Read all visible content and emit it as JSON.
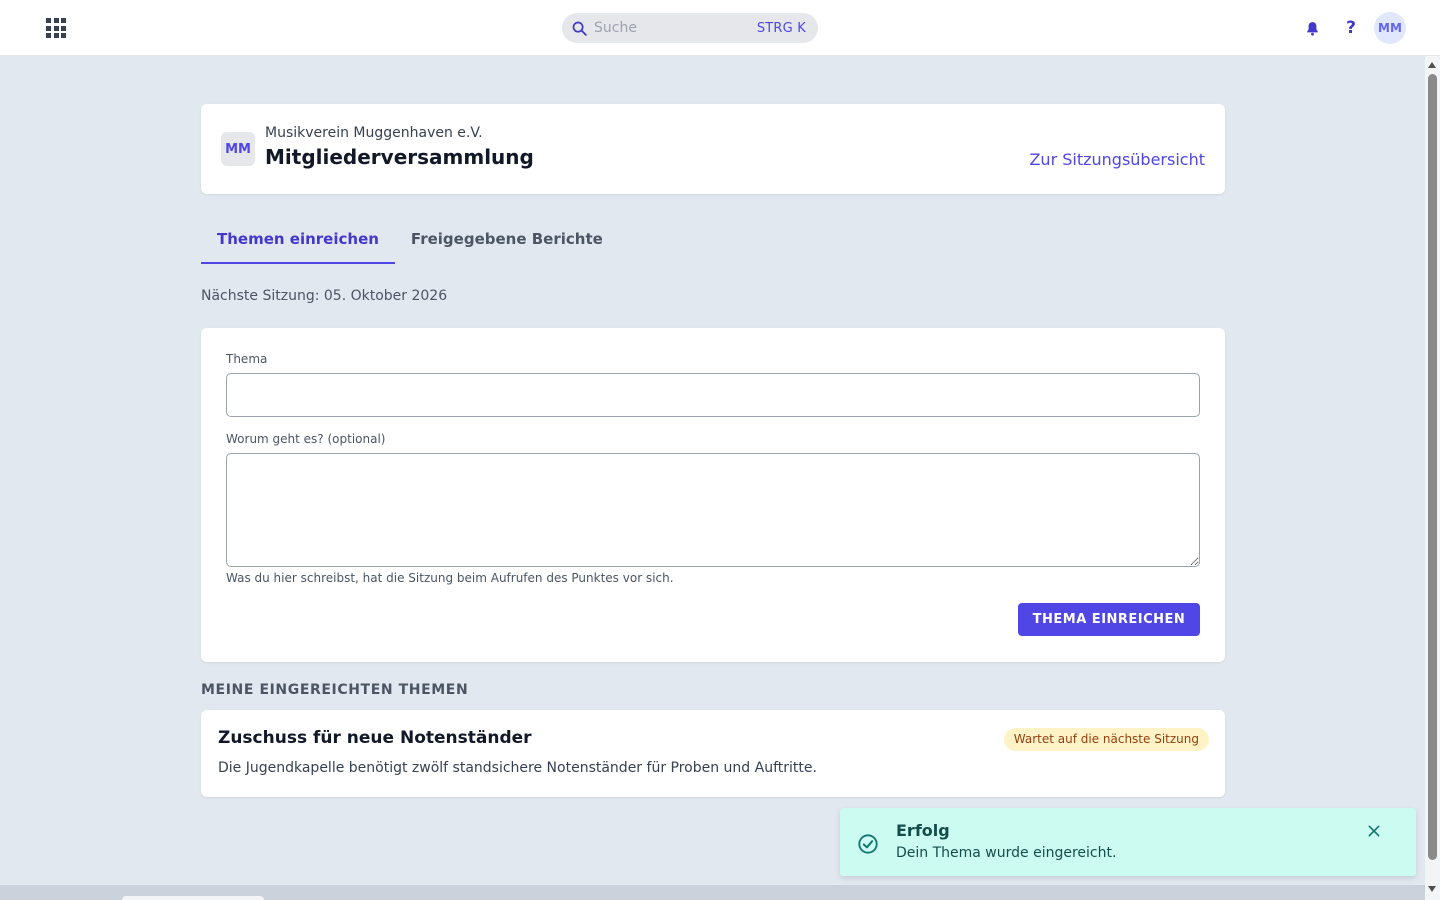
{
  "topbar": {
    "search_placeholder": "Suche",
    "search_shortcut": "STRG K",
    "help_label": "?",
    "avatar_initials": "MM"
  },
  "header": {
    "badge_initials": "MM",
    "organization": "Musikverein Muggenhaven e.V.",
    "title": "Mitgliederversammlung",
    "overview_link": "Zur Sitzungsübersicht"
  },
  "tabs": [
    {
      "label": "Themen einreichen",
      "active": true
    },
    {
      "label": "Freigegebene Berichte",
      "active": false
    }
  ],
  "next_session": "Nächste Sitzung: 05. Oktober 2026",
  "form": {
    "topic_label": "Thema",
    "topic_value": "",
    "description_label": "Worum geht es? (optional)",
    "description_value": "",
    "helper_text": "Was du hier schreibst, hat die Sitzung beim Aufrufen des Punktes vor sich.",
    "submit_label": "THEMA EINREICHEN"
  },
  "my_topics": {
    "heading": "MEINE EINGEREICHTEN THEMEN",
    "items": [
      {
        "title": "Zuschuss für neue Notenständer",
        "description": "Die Jugendkapelle benötigt zwölf standsichere Notenständer für Proben und Auftritte.",
        "status": "Wartet auf die nächste Sitzung"
      }
    ]
  },
  "toast": {
    "title": "Erfolg",
    "message": "Dein Thema wurde eingereicht."
  },
  "colors": {
    "accent": "#4f46e5",
    "background": "#e2e8f0",
    "toast_bg": "#ccfbf1",
    "status_bg": "#fef3c7",
    "status_text": "#92400e"
  },
  "icons": [
    "apps-grid-icon",
    "search-icon",
    "bell-icon",
    "help-icon",
    "check-circle-icon",
    "close-icon"
  ]
}
